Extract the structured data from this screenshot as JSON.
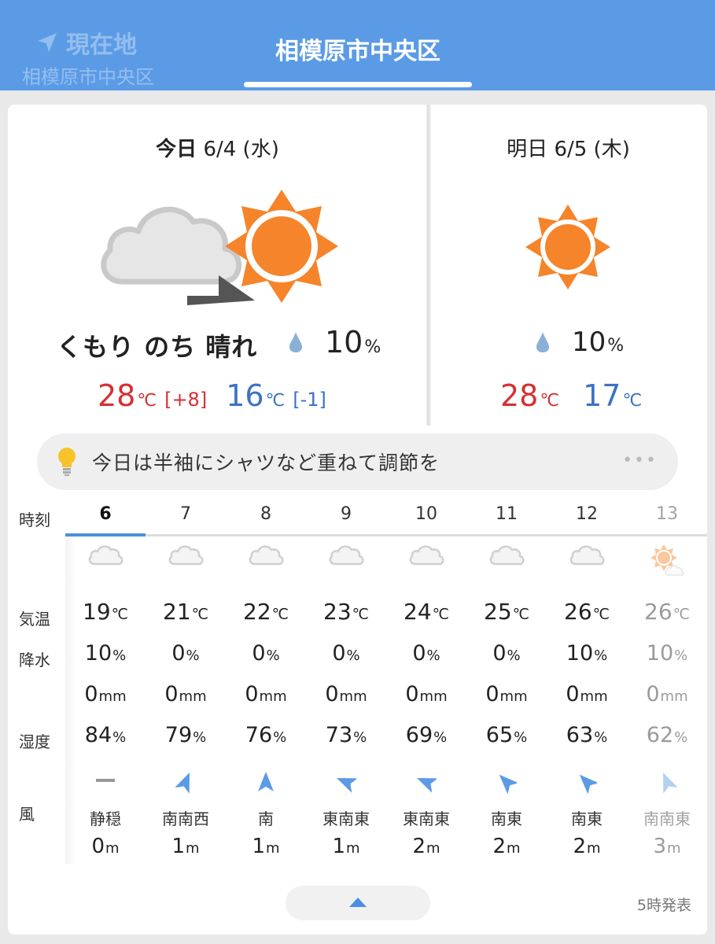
{
  "header": {
    "current_location_label": "現在地",
    "current_location_city": "相模原市中央区",
    "selected_city": "相模原市中央区"
  },
  "today": {
    "date_prefix": "今日",
    "date": "6/4 (水)",
    "weather": "くもり のち 晴れ",
    "pop": "10",
    "pop_unit": "%",
    "high": "28",
    "high_unit": "℃",
    "high_diff": "[+8]",
    "low": "16",
    "low_unit": "℃",
    "low_diff": "[-1]",
    "icon": "cloudy-then-sunny-icon"
  },
  "tomorrow": {
    "date_prefix": "明日",
    "date": "6/5 (木)",
    "pop": "10",
    "pop_unit": "%",
    "high": "28",
    "high_unit": "℃",
    "low": "17",
    "low_unit": "℃",
    "icon": "sunny-icon"
  },
  "advice": {
    "text": "今日は半袖にシャツなど重ねて調節を",
    "more": "•••"
  },
  "hourly_labels": {
    "time": "時刻",
    "temp": "気温",
    "precip": "降水",
    "humidity": "湿度",
    "wind": "風"
  },
  "units": {
    "temp": "℃",
    "pct": "%",
    "mm": "mm",
    "m": "m"
  },
  "hourly": [
    {
      "hour": "6",
      "icon": "cloud-icon",
      "temp": "19",
      "pop": "10",
      "mm": "0",
      "hum": "84",
      "wind_dir": "静穏",
      "wind_speed": "0"
    },
    {
      "hour": "7",
      "icon": "cloud-icon",
      "temp": "21",
      "pop": "0",
      "mm": "0",
      "hum": "79",
      "wind_dir": "南南西",
      "wind_speed": "1"
    },
    {
      "hour": "8",
      "icon": "cloud-icon",
      "temp": "22",
      "pop": "0",
      "mm": "0",
      "hum": "76",
      "wind_dir": "南",
      "wind_speed": "1"
    },
    {
      "hour": "9",
      "icon": "cloud-icon",
      "temp": "23",
      "pop": "0",
      "mm": "0",
      "hum": "73",
      "wind_dir": "東南東",
      "wind_speed": "1"
    },
    {
      "hour": "10",
      "icon": "cloud-icon",
      "temp": "24",
      "pop": "0",
      "mm": "0",
      "hum": "69",
      "wind_dir": "東南東",
      "wind_speed": "2"
    },
    {
      "hour": "11",
      "icon": "cloud-icon",
      "temp": "25",
      "pop": "0",
      "mm": "0",
      "hum": "65",
      "wind_dir": "南東",
      "wind_speed": "2"
    },
    {
      "hour": "12",
      "icon": "cloud-icon",
      "temp": "26",
      "pop": "10",
      "mm": "0",
      "hum": "63",
      "wind_dir": "南東",
      "wind_speed": "2"
    },
    {
      "hour": "13",
      "icon": "sun-with-cloud-icon",
      "temp": "26",
      "pop": "10",
      "mm": "0",
      "hum": "62",
      "wind_dir": "南南東",
      "wind_speed": "3"
    }
  ],
  "footer": {
    "issued": "5時発表"
  },
  "colors": {
    "header": "#5b9be6",
    "high": "#d53033",
    "low": "#3d72c4",
    "sun": "#f5842a",
    "accent": "#4a8fe0"
  }
}
